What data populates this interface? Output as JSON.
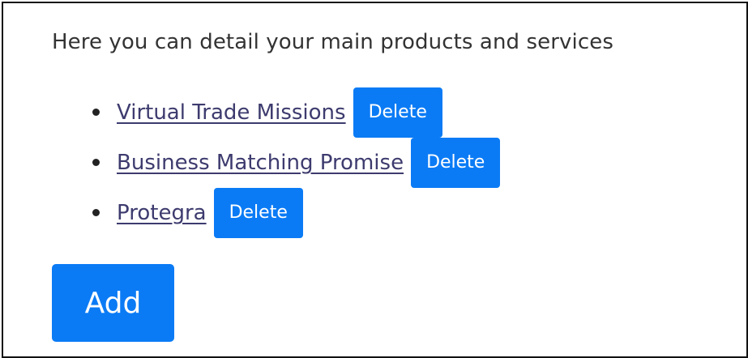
{
  "intro": {
    "text": "Here you can detail your main products and services"
  },
  "products": [
    {
      "name": "Virtual Trade Missions",
      "delete_label": "Delete"
    },
    {
      "name": "Business Matching Promise",
      "delete_label": "Delete"
    },
    {
      "name": "Protegra",
      "delete_label": "Delete"
    }
  ],
  "actions": {
    "add_label": "Add"
  },
  "colors": {
    "accent": "#0b7bf5",
    "link": "#3d3b6e",
    "text": "#333333",
    "border": "#111111"
  }
}
